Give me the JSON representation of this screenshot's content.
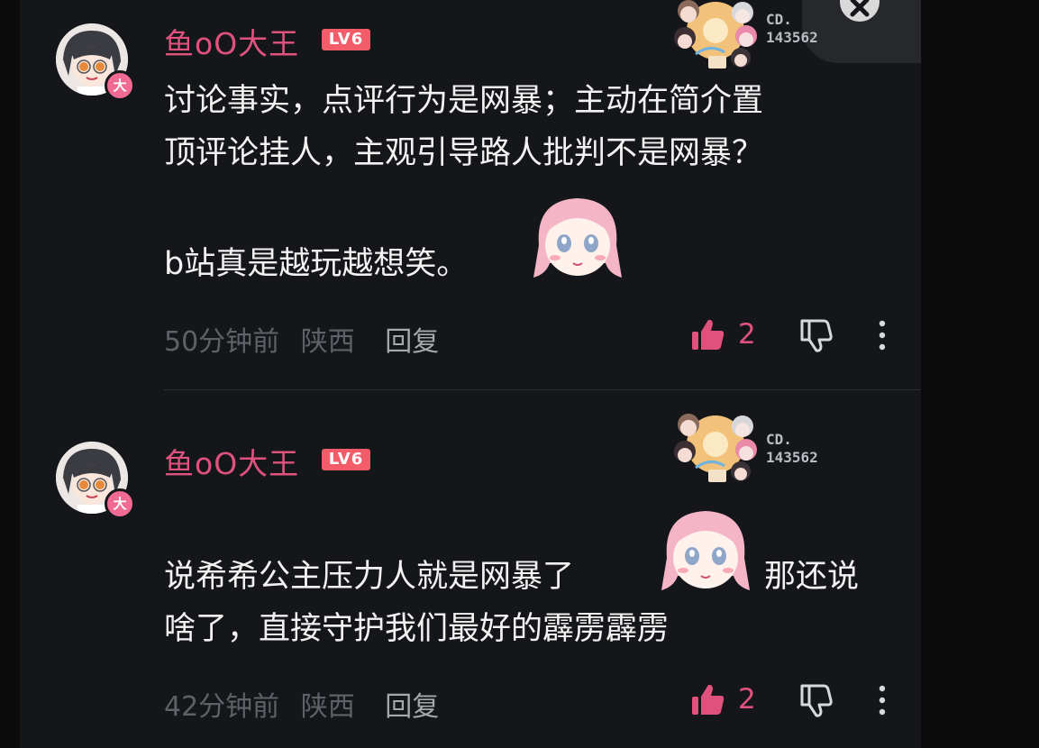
{
  "comments": [
    {
      "username": "鱼oO大王",
      "level": "LV6",
      "badge_char": "大",
      "fan_number_prefix": "CD.",
      "fan_number": "143562",
      "text_lines": [
        "讨论事实，点评行为是网暴；主动在简介置",
        "顶评论挂人，主观引导路人批判不是网暴？",
        "",
        "b站真是越玩越想笑。"
      ],
      "time": "50分钟前",
      "location": "陕西",
      "reply_label": "回复",
      "likes": "2"
    },
    {
      "username": "鱼oO大王",
      "level": "LV6",
      "badge_char": "大",
      "fan_number_prefix": "CD.",
      "fan_number": "143562",
      "text_lines": [
        "说希希公主压力人就是网暴了",
        "那还说",
        "啥了，直接守护我们最好的霹雳霹雳"
      ],
      "time": "42分钟前",
      "location": "陕西",
      "reply_label": "回复",
      "likes": "2"
    }
  ],
  "colors": {
    "username": "#e0527e",
    "level_badge": "#f35d6a",
    "like_active": "#e0527e",
    "background": "#141619",
    "text": "#f2f2f2",
    "meta": "#5e6167"
  },
  "icons": [
    "thumbs-up-icon",
    "thumbs-down-icon",
    "more-vertical-icon",
    "close-icon"
  ]
}
